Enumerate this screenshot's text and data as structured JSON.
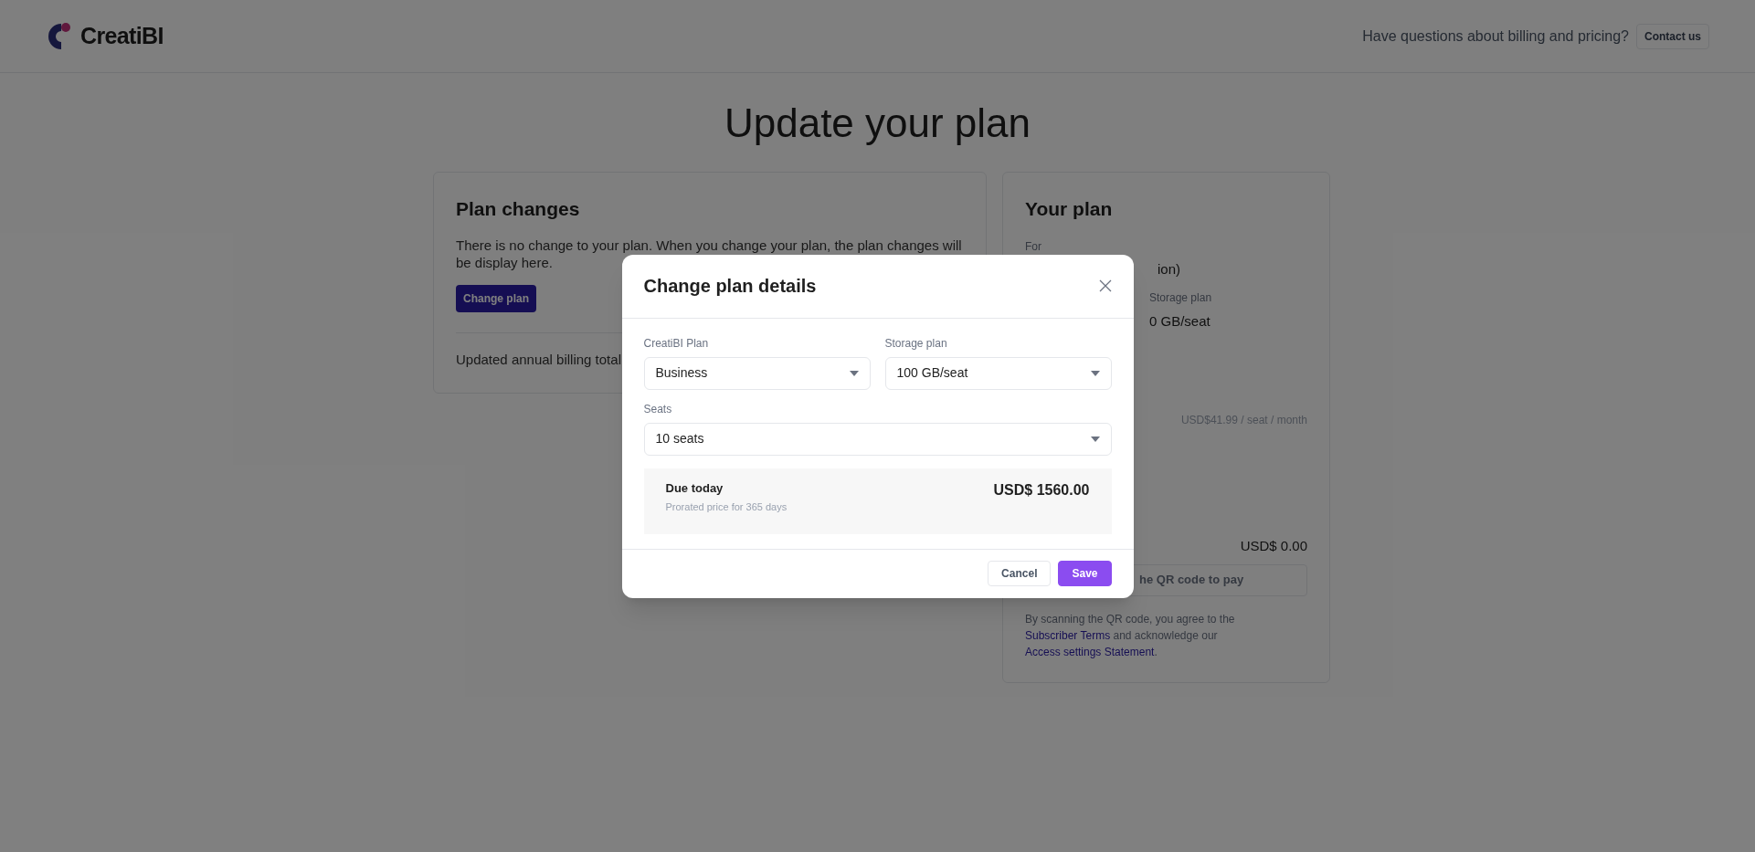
{
  "header": {
    "brand": "CreatiBI",
    "question": "Have questions about billing and pricing?",
    "contact_button": "Contact us"
  },
  "page_title": "Update your plan",
  "plan_changes": {
    "title": "Plan changes",
    "message": "There is no change to your plan. When you change your plan, the plan changes will be display here.",
    "change_button": "Change plan",
    "billing_total_label": "Updated annual billing total"
  },
  "your_plan": {
    "title": "Your plan",
    "for_label": "For",
    "for_value": "ion)",
    "storage_label": "Storage plan",
    "storage_value": "0 GB/seat",
    "price_per_seat": "USD$41.99 / seat / month",
    "total": "USD$ 0.00",
    "qr_button": "he QR code to pay",
    "terms": {
      "before": "By scanning the QR code, you agree to the",
      "link_1": "Subscriber Terms",
      "middle": "and acknowledge our",
      "link_2": "Access settings Statement",
      "after": "."
    }
  },
  "modal": {
    "title": "Change plan details",
    "fields": [
      {
        "label": "CreatiBI Plan",
        "value": "Business"
      },
      {
        "label": "Storage plan",
        "value": "100 GB/seat"
      },
      {
        "label": "Seats",
        "value": "10 seats"
      }
    ],
    "due": {
      "label": "Due today",
      "note": "Prorated price for 365 days",
      "amount": "USD$ 1560.00"
    },
    "buttons": [
      {
        "label": "Cancel",
        "kind": "secondary"
      },
      {
        "label": "Save",
        "kind": "primary"
      }
    ]
  }
}
